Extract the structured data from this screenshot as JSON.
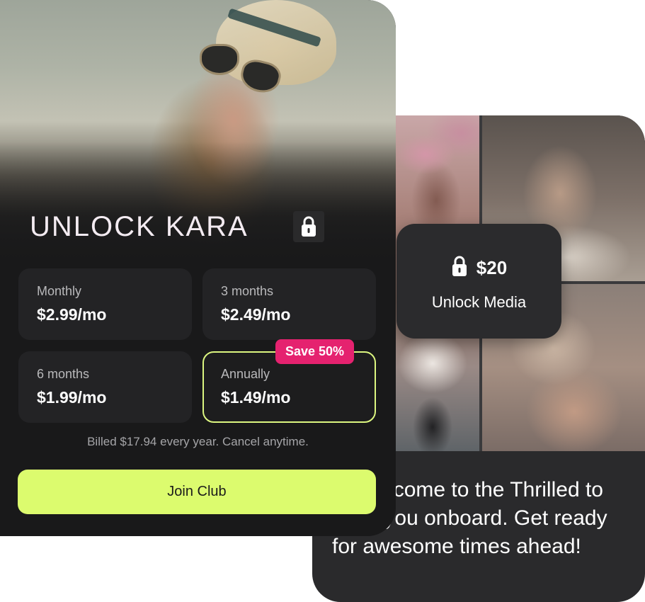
{
  "paywall": {
    "title": "UNLOCK KARA",
    "plans": [
      {
        "name": "Monthly",
        "price": "$2.99/mo"
      },
      {
        "name": "3 months",
        "price": "$2.49/mo"
      },
      {
        "name": "6 months",
        "price": "$1.99/mo"
      },
      {
        "name": "Annually",
        "price": "$1.49/mo",
        "selected": true
      }
    ],
    "badge": "Save 50%",
    "billing_note": "Billed $17.94 every year. Cancel anytime.",
    "cta_label": "Join Club"
  },
  "media_card": {
    "price": "$20",
    "unlock_label": "Unlock Media",
    "message": "nd welcome to the Thrilled to have you onboard. Get ready for awesome times ahead!"
  },
  "colors": {
    "accent": "#dcfb6e",
    "badge": "#e5226f",
    "card_bg": "#19191a"
  },
  "icons": [
    "lock-icon"
  ]
}
